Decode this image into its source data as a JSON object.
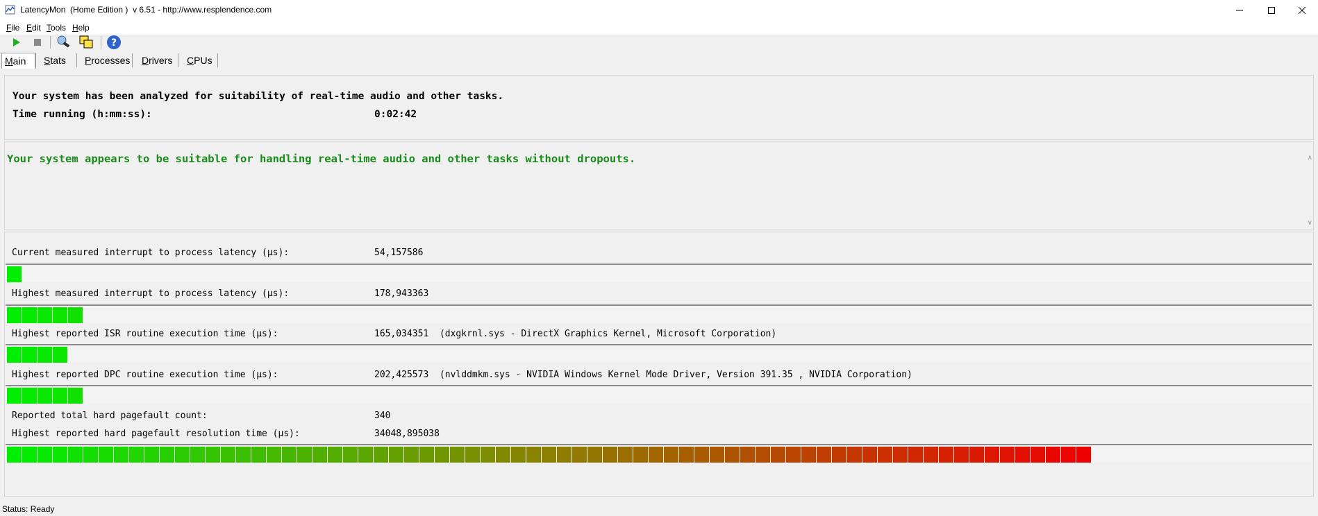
{
  "window": {
    "title": "LatencyMon  (Home Edition )  v 6.51 - http://www.resplendence.com"
  },
  "menu": [
    {
      "label": "File",
      "u": "F",
      "rest": "ile"
    },
    {
      "label": "Edit",
      "u": "E",
      "rest": "dit"
    },
    {
      "label": "Tools",
      "u": "T",
      "rest": "ools"
    },
    {
      "label": "Help",
      "u": "H",
      "rest": "elp"
    }
  ],
  "toolbar": {
    "icons": [
      "play-icon",
      "stop-icon",
      "drivers-icon",
      "windows-icon",
      "help-icon"
    ]
  },
  "tabs": [
    {
      "label": "Main",
      "u": "M",
      "rest": "ain",
      "active": true
    },
    {
      "label": "Stats",
      "u": "S",
      "rest": "tats",
      "active": false
    },
    {
      "label": "Processes",
      "u": "P",
      "rest": "rocesses",
      "active": false
    },
    {
      "label": "Drivers",
      "u": "D",
      "rest": "rivers",
      "active": false
    },
    {
      "label": "CPUs",
      "u": "C",
      "rest": "PUs",
      "active": false
    }
  ],
  "summary": {
    "analyzed": "Your system has been analyzed for suitability of real-time audio and other tasks.",
    "time_label": "Time running (h:mm:ss):",
    "time_value": "0:02:42"
  },
  "verdict": "Your system appears to be suitable for handling real-time audio and other tasks without dropouts.",
  "metrics": {
    "current_latency": {
      "label": "Current measured interrupt to process latency (µs):",
      "value": "54,157586",
      "bar_segments": 1
    },
    "highest_latency": {
      "label": "Highest measured interrupt to process latency (µs):",
      "value": "178,943363",
      "bar_segments": 5
    },
    "isr": {
      "label": "Highest reported ISR routine execution time (µs):",
      "value": "165,034351",
      "detail": "(dxgkrnl.sys - DirectX Graphics Kernel, Microsoft Corporation)",
      "bar_segments": 4
    },
    "dpc": {
      "label": "Highest reported DPC routine execution time (µs):",
      "value": "202,425573",
      "detail": "(nvlddmkm.sys - NVIDIA Windows Kernel Mode Driver, Version 391.35 , NVIDIA Corporation)",
      "bar_segments": 5
    },
    "pagefault_count": {
      "label": "Reported total hard pagefault count:",
      "value": "340"
    },
    "pagefault_time": {
      "label": "Highest reported hard pagefault resolution time (µs):",
      "value": "34048,895038",
      "bar_segments": 71
    }
  },
  "colors": {
    "verdict_green": "#1a8b1a",
    "bar_start": "#00ee00",
    "bar_end": "#ee0000"
  },
  "status": "Status: Ready"
}
